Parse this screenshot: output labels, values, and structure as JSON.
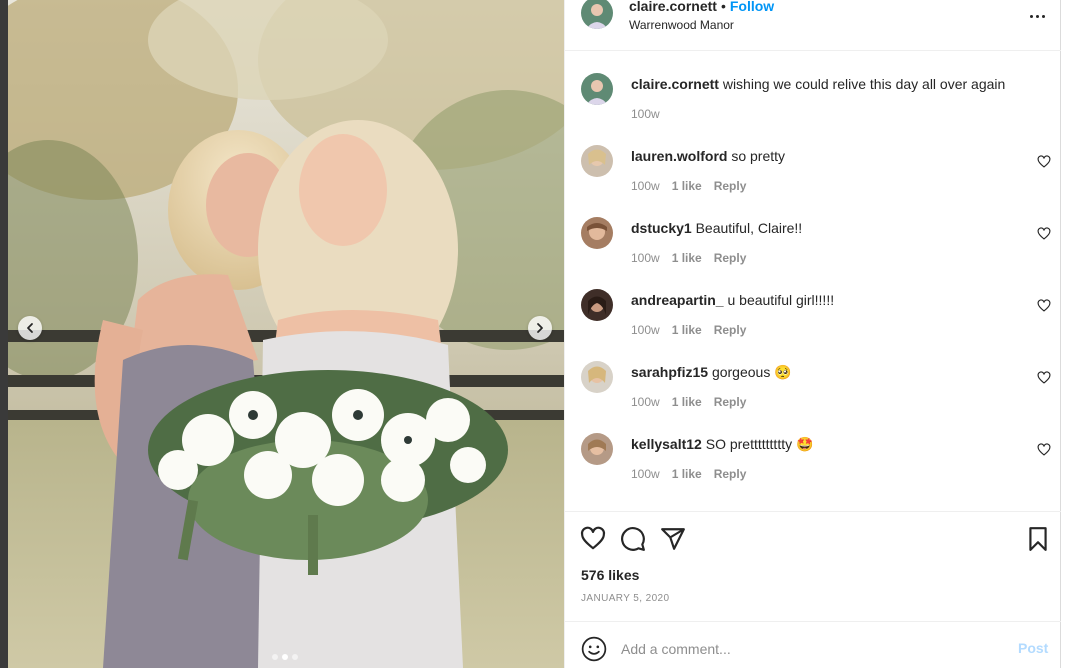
{
  "post": {
    "username": "claire.cornett",
    "follow_label": "Follow",
    "separator": "•",
    "location": "Warrenwood Manor",
    "more_icon": "more-horizontal-icon",
    "carousel": {
      "current_slide": 2,
      "total_slides": 3
    }
  },
  "caption": {
    "username": "claire.cornett",
    "text": "wishing we could relive this day all over again",
    "age": "100w"
  },
  "comments": [
    {
      "username": "lauren.wolford",
      "text": "so pretty",
      "age": "100w",
      "likes": "1 like",
      "reply": "Reply"
    },
    {
      "username": "dstucky1",
      "text": "Beautiful, Claire!!",
      "age": "100w",
      "likes": "1 like",
      "reply": "Reply"
    },
    {
      "username": "andreapartin_",
      "text": "u beautiful girl!!!!!",
      "age": "100w",
      "likes": "1 like",
      "reply": "Reply"
    },
    {
      "username": "sarahpfiz15",
      "text": "gorgeous 🥺",
      "age": "100w",
      "likes": "1 like",
      "reply": "Reply"
    },
    {
      "username": "kellysalt12",
      "text": "SO prettttttttty 🤩",
      "age": "100w",
      "likes": "1 like",
      "reply": "Reply"
    }
  ],
  "actions": {
    "likes_label": "576 likes",
    "date": "JANUARY 5, 2020"
  },
  "add_comment": {
    "placeholder": "Add a comment...",
    "post_label": "Post"
  },
  "colors": {
    "accent": "#0095f6",
    "post_disabled": "#b3dbff",
    "meta": "#8e8e8e",
    "text": "#262626"
  }
}
